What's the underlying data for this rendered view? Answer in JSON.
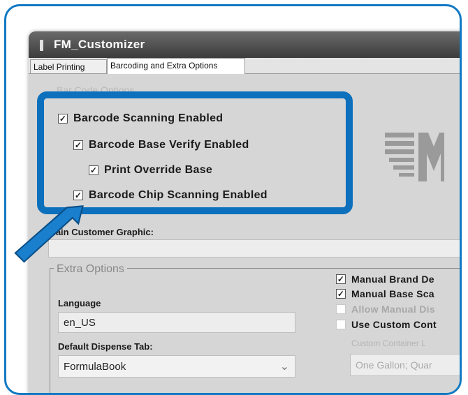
{
  "window": {
    "title": "FM_Customizer"
  },
  "tabs": [
    {
      "label": "Label Printing",
      "active": false
    },
    {
      "label": "Barcoding and Extra Options",
      "active": true
    }
  ],
  "barcode_options": {
    "group_title": "Bar Code Options",
    "items": [
      {
        "label": "Barcode Scanning Enabled",
        "checked": true
      },
      {
        "label": "Barcode Base Verify Enabled",
        "checked": true
      },
      {
        "label": "Print Override Base",
        "checked": true
      },
      {
        "label": "Barcode Chip Scanning Enabled",
        "checked": true
      }
    ]
  },
  "customer_graphic": {
    "label": "Main Customer Graphic:",
    "value": ""
  },
  "extra_options": {
    "legend": "Extra Options",
    "language_label": "Language",
    "language_value": "en_US",
    "dispense_tab_label": "Default Dispense Tab:",
    "dispense_tab_value": "FormulaBook",
    "right_checks": [
      {
        "label": "Manual Brand De",
        "checked": true,
        "enabled": true
      },
      {
        "label": "Manual Base Sca",
        "checked": true,
        "enabled": true
      },
      {
        "label": "Allow Manual Dis",
        "checked": false,
        "enabled": false
      },
      {
        "label": "Use Custom Cont",
        "checked": false,
        "enabled": true
      }
    ],
    "custom_container_label": "Custom Container L",
    "custom_container_value": "One Gallon; Quar"
  },
  "colors": {
    "highlight": "#0d70bd",
    "arrow": "#1a7fcd",
    "titlebar": "#4a4a4a"
  }
}
